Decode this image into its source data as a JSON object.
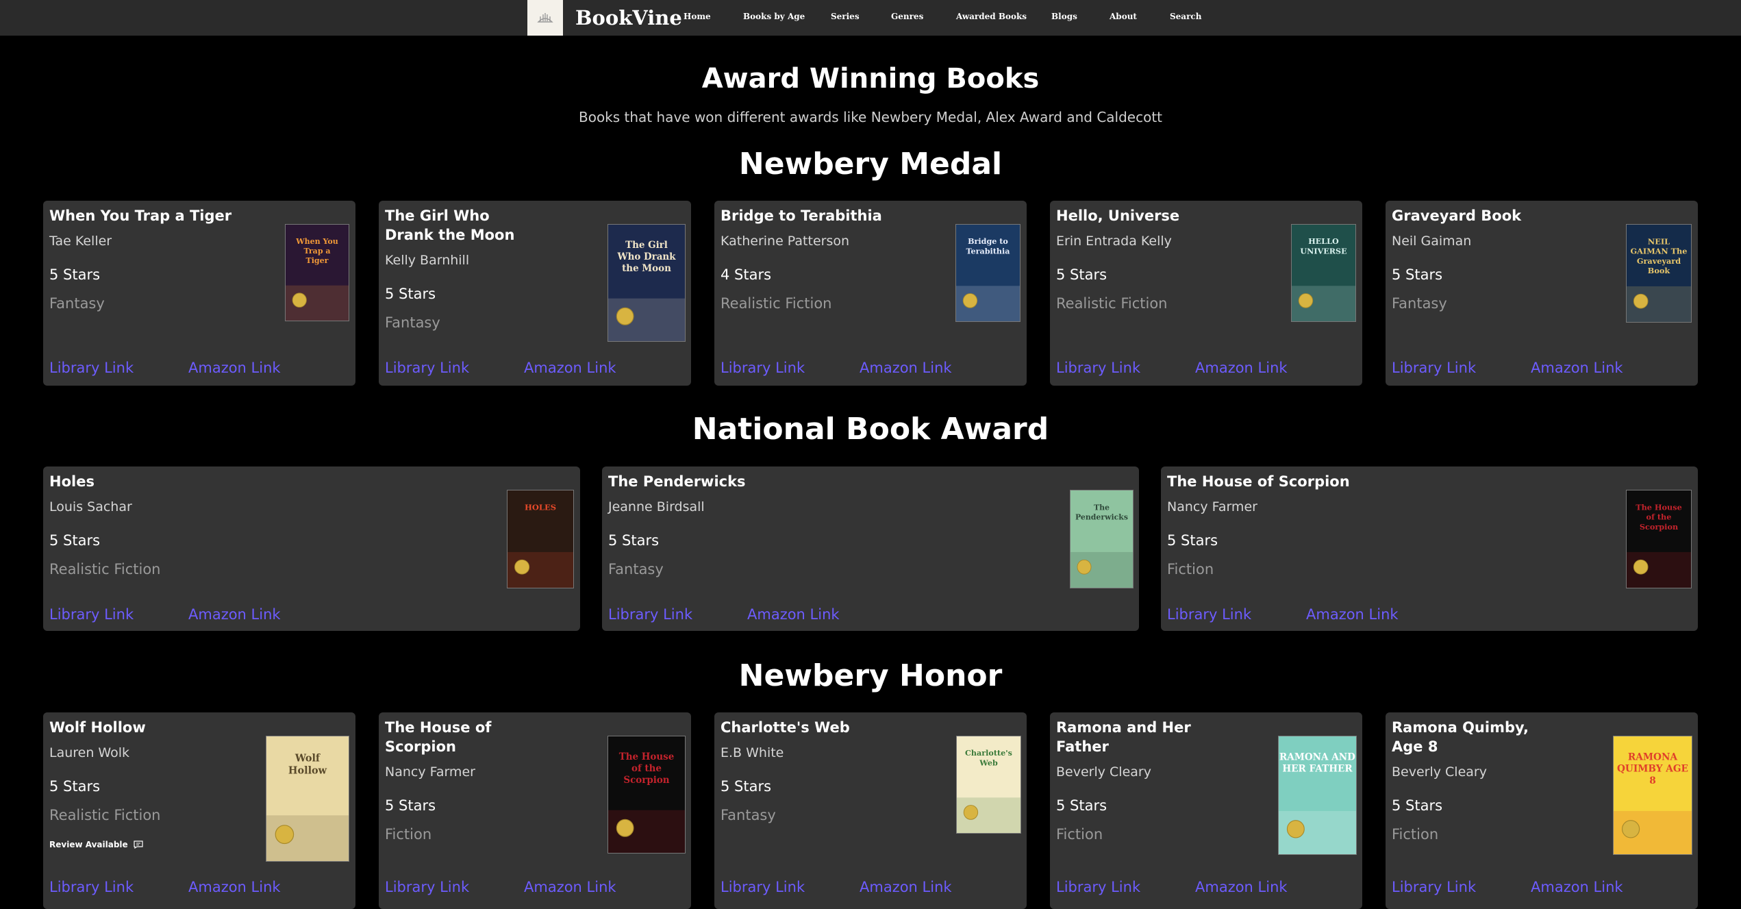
{
  "nav": {
    "brand": "BookVine",
    "links": [
      "Home",
      "Books by Age",
      "Series",
      "Genres",
      "Awarded Books",
      "Blogs",
      "About",
      "Search"
    ]
  },
  "page": {
    "title": "Award Winning Books",
    "subtitle": "Books that have won different awards like Newbery Medal, Alex Award and Caldecott"
  },
  "link_labels": {
    "library": "Library Link",
    "amazon": "Amazon Link"
  },
  "sections": [
    {
      "title": "Newbery Medal",
      "books": [
        {
          "title": "When You Trap a Tiger",
          "author": "Tae Keller",
          "stars": "5 Stars",
          "genre": "Fantasy",
          "cover_text": "When You Trap a Tiger",
          "cover_bg": "#2a1733",
          "cover_fg": "#f29a38"
        },
        {
          "title": "The Girl Who Drank the Moon",
          "author": "Kelly Barnhill",
          "stars": "5 Stars",
          "genre": "Fantasy",
          "cover_text": "The Girl Who Drank the Moon",
          "cover_bg": "#1d2a4d",
          "cover_fg": "#f2e6c8"
        },
        {
          "title": "Bridge to Terabithia",
          "author": "Katherine Patterson",
          "stars": "4 Stars",
          "genre": "Realistic Fiction",
          "cover_text": "Bridge to Terabithia",
          "cover_bg": "#1b3a63",
          "cover_fg": "#e8eefc"
        },
        {
          "title": "Hello, Universe",
          "author": "Erin Entrada Kelly",
          "stars": "5 Stars",
          "genre": "Realistic Fiction",
          "cover_text": "HELLO UNIVERSE",
          "cover_bg": "#1f4f4a",
          "cover_fg": "#d9f2ee"
        },
        {
          "title": "Graveyard Book",
          "author": "Neil Gaiman",
          "stars": "5 Stars",
          "genre": "Fantasy",
          "cover_text": "NEIL GAIMAN The Graveyard Book",
          "cover_bg": "#142b4a",
          "cover_fg": "#e8c66a"
        }
      ]
    },
    {
      "title": "National Book Award",
      "books": [
        {
          "title": "Holes",
          "author": "Louis Sachar",
          "stars": "5 Stars",
          "genre": "Realistic Fiction",
          "cover_text": "HOLES",
          "cover_bg": "#2a1a12",
          "cover_fg": "#e94a2a"
        },
        {
          "title": "The Penderwicks",
          "author": "Jeanne Birdsall",
          "stars": "5 Stars",
          "genre": "Fantasy",
          "cover_text": "The Penderwicks",
          "cover_bg": "#8fc4a0",
          "cover_fg": "#2f4a3a"
        },
        {
          "title": "The House of Scorpion",
          "author": "Nancy Farmer",
          "stars": "5 Stars",
          "genre": "Fiction",
          "cover_text": "The House of the Scorpion",
          "cover_bg": "#0c0c0c",
          "cover_fg": "#c4232c"
        }
      ]
    },
    {
      "title": "Newbery Honor",
      "books": [
        {
          "title": "Wolf Hollow",
          "author": "Lauren Wolk",
          "stars": "5 Stars",
          "genre": "Realistic Fiction",
          "review": "Review Available",
          "cover_text": "Wolf Hollow",
          "cover_bg": "#e9d9a4",
          "cover_fg": "#5a4a2a"
        },
        {
          "title": "The House of Scorpion",
          "author": "Nancy Farmer",
          "stars": "5 Stars",
          "genre": "Fiction",
          "cover_text": "The House of the Scorpion",
          "cover_bg": "#0c0c0c",
          "cover_fg": "#c4232c"
        },
        {
          "title": "Charlotte's Web",
          "author": "E.B White",
          "stars": "5 Stars",
          "genre": "Fantasy",
          "cover_text": "Charlotte's Web",
          "cover_bg": "#f3ebc8",
          "cover_fg": "#3a7a3a"
        },
        {
          "title": "Ramona and Her Father",
          "author": "Beverly Cleary",
          "stars": "5 Stars",
          "genre": "Fiction",
          "cover_text": "RAMONA AND HER FATHER",
          "cover_bg": "#7fcfc0",
          "cover_fg": "#ffffff"
        },
        {
          "title": "Ramona Quimby, Age 8",
          "author": "Beverly Cleary",
          "stars": "5 Stars",
          "genre": "Fiction",
          "cover_text": "RAMONA QUIMBY AGE 8",
          "cover_bg": "#f6d43a",
          "cover_fg": "#e0402a"
        }
      ]
    }
  ]
}
